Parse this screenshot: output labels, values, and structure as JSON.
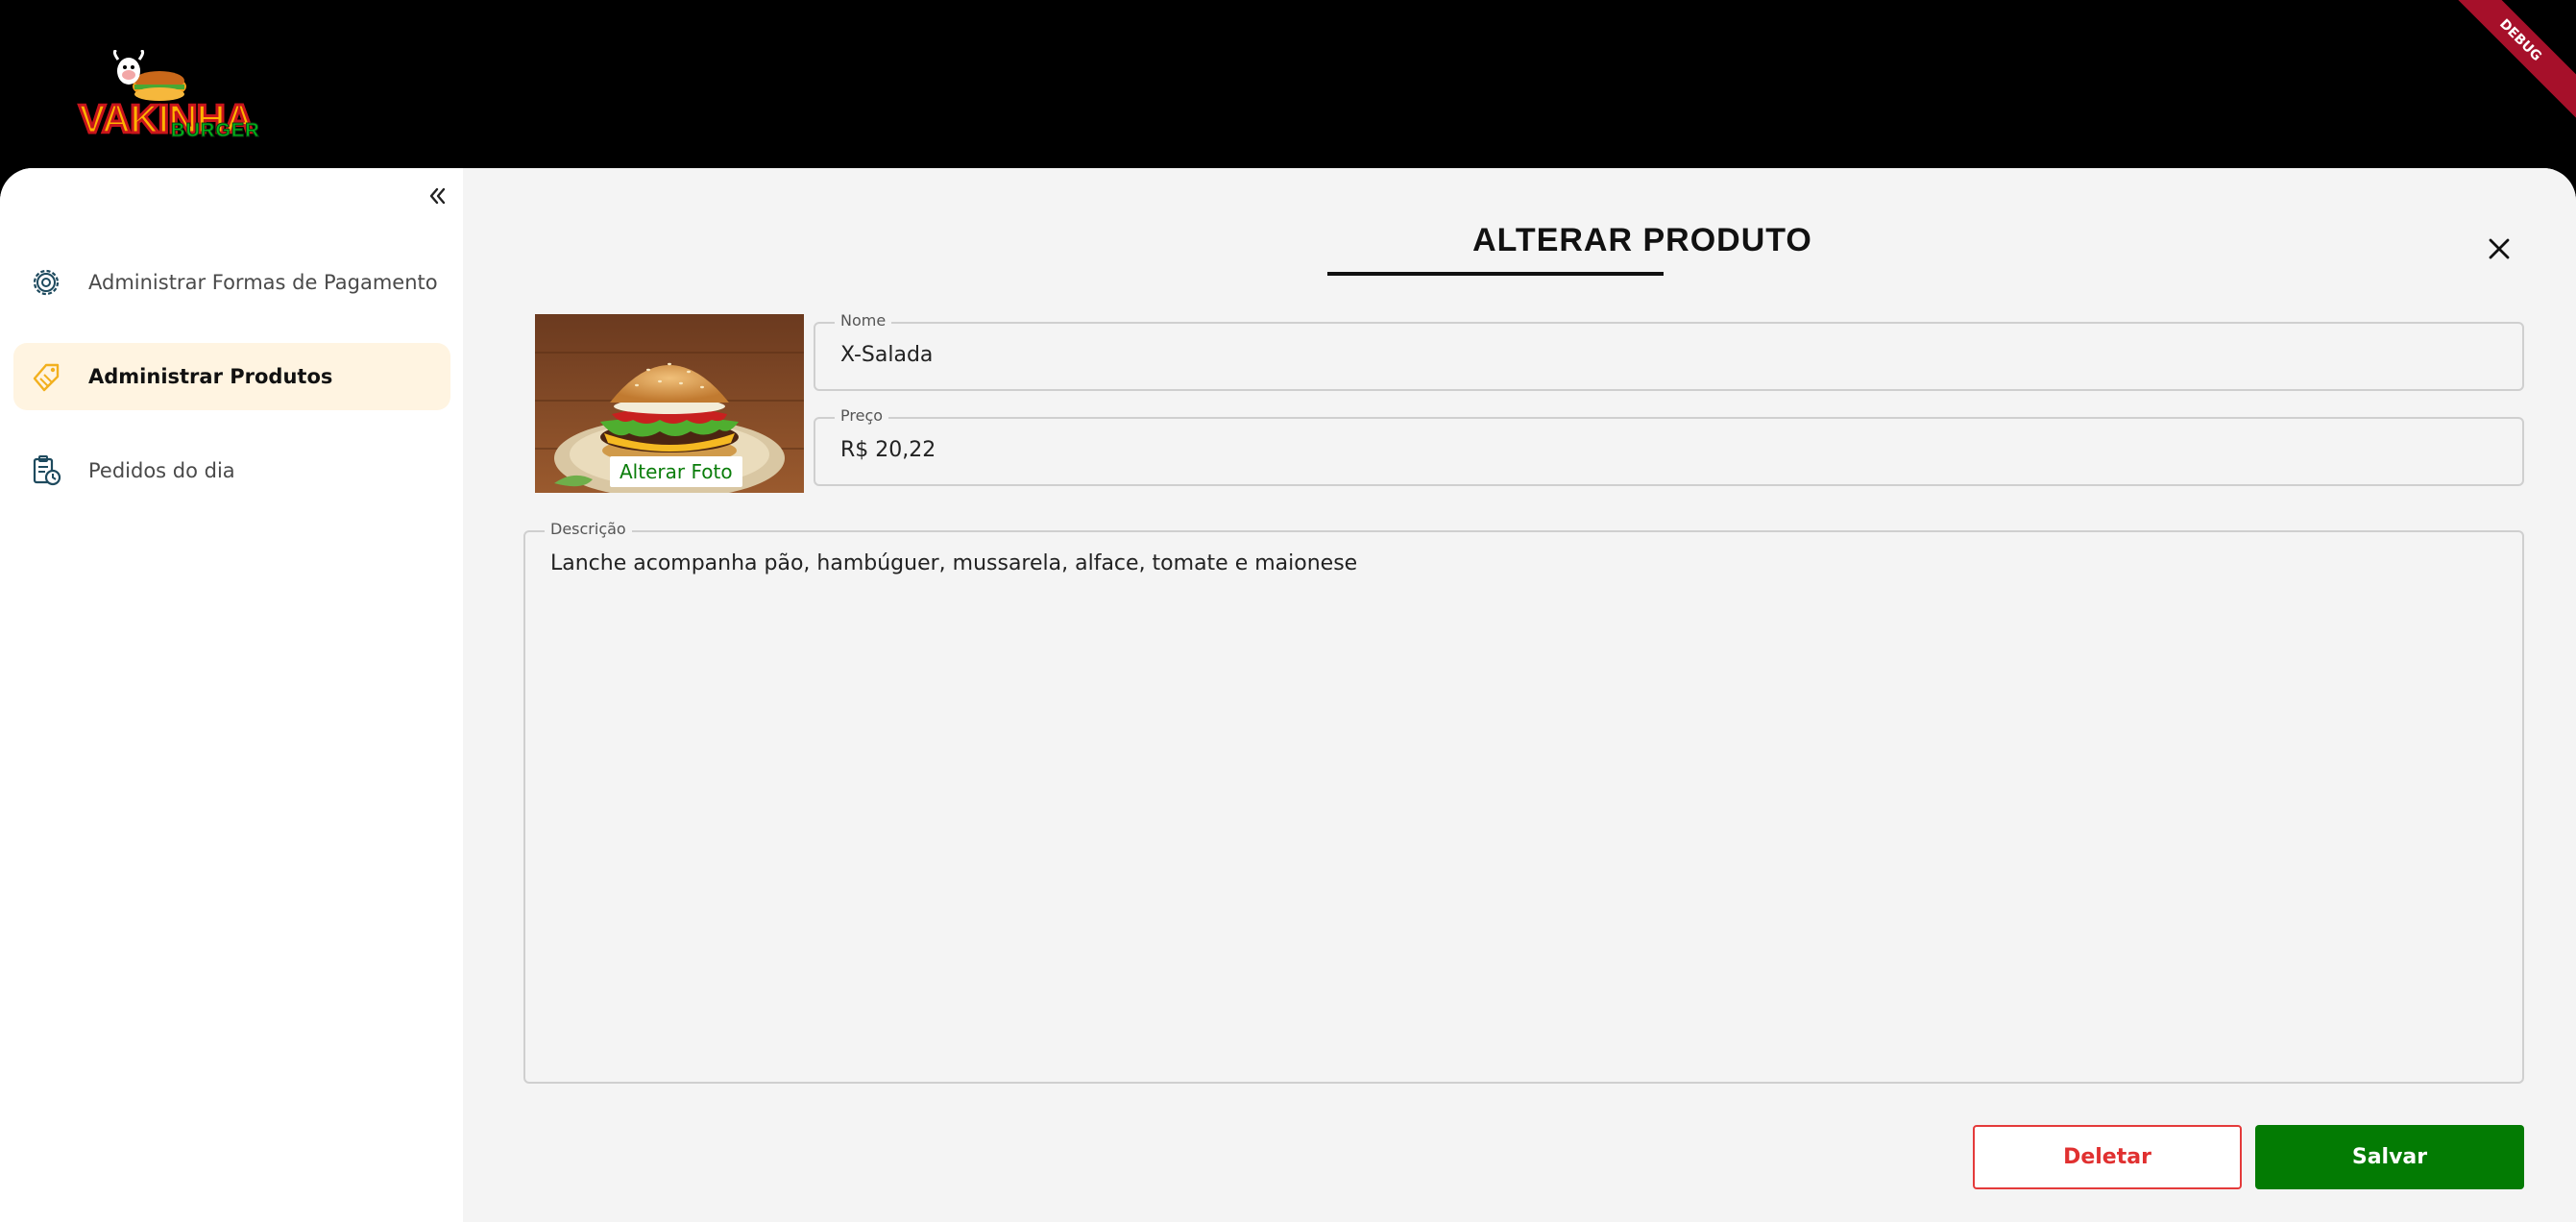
{
  "header": {
    "logo_text": "VAKINHA",
    "logo_sub": "BURGER",
    "debug_banner": "DEBUG"
  },
  "sidebar": {
    "items": [
      {
        "label": "Administrar Formas de Pagamento",
        "icon": "gear-icon",
        "active": false
      },
      {
        "label": "Administrar Produtos",
        "icon": "tag-icon",
        "active": true
      },
      {
        "label": "Pedidos do dia",
        "icon": "clipboard-clock-icon",
        "active": false
      }
    ]
  },
  "form": {
    "title": "ALTERAR PRODUTO",
    "alter_photo_label": "Alterar Foto",
    "name": {
      "label": "Nome",
      "value": "X-Salada"
    },
    "price": {
      "label": "Preço",
      "value": "R$ 20,22"
    },
    "description": {
      "label": "Descrição",
      "value": "Lanche acompanha pão, hambúguer, mussarela, alface, tomate e maionese"
    },
    "delete_label": "Deletar",
    "save_label": "Salvar"
  },
  "colors": {
    "accent_green": "#037b03",
    "danger_red": "#e03030",
    "active_nav_bg": "#fff4e1",
    "ribbon": "#a6102a"
  }
}
